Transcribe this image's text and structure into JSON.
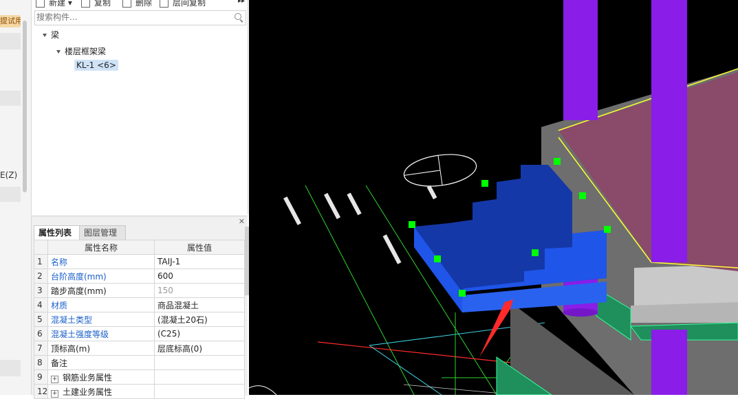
{
  "left_strip": {
    "trial_badge": "提试用",
    "partial_label": "E(Z)"
  },
  "toolbar": {
    "new_label": "新建",
    "copy_label": "复制",
    "delete_label": "删除",
    "floor_copy_label": "层间复制"
  },
  "search": {
    "placeholder": "搜索构件..."
  },
  "tree": {
    "root": "梁",
    "child": "楼层框架梁",
    "leaf": "KL-1 <6>"
  },
  "props": {
    "tabs": [
      "属性列表",
      "图层管理"
    ],
    "headers": {
      "name": "属性名称",
      "value": "属性值"
    },
    "rows": [
      {
        "n": "1",
        "name": "名称",
        "value": "TAIJ-1"
      },
      {
        "n": "2",
        "name": "台阶高度(mm)",
        "value": "600"
      },
      {
        "n": "3",
        "name": "踏步高度(mm)",
        "value": "150"
      },
      {
        "n": "4",
        "name": "材质",
        "value": "商品混凝土"
      },
      {
        "n": "5",
        "name": "混凝土类型",
        "value": "(混凝土20石)"
      },
      {
        "n": "6",
        "name": "混凝土强度等级",
        "value": "(C25)"
      },
      {
        "n": "7",
        "name": "顶标高(m)",
        "value": "层底标高(0)"
      },
      {
        "n": "8",
        "name": "备注",
        "value": ""
      },
      {
        "n": "9",
        "name": "钢筋业务属性",
        "value": ""
      },
      {
        "n": "12",
        "name": "土建业务属性",
        "value": ""
      }
    ]
  },
  "colors": {
    "step_blue": "#1f55e8",
    "step_dark": "#1538a8",
    "column_purple": "#8a1de8",
    "slab_pink": "#8a4a6a",
    "grip_green": "#00ff00",
    "highlight_yellow": "#ffff33",
    "arrow_red": "#ff2a2a"
  }
}
